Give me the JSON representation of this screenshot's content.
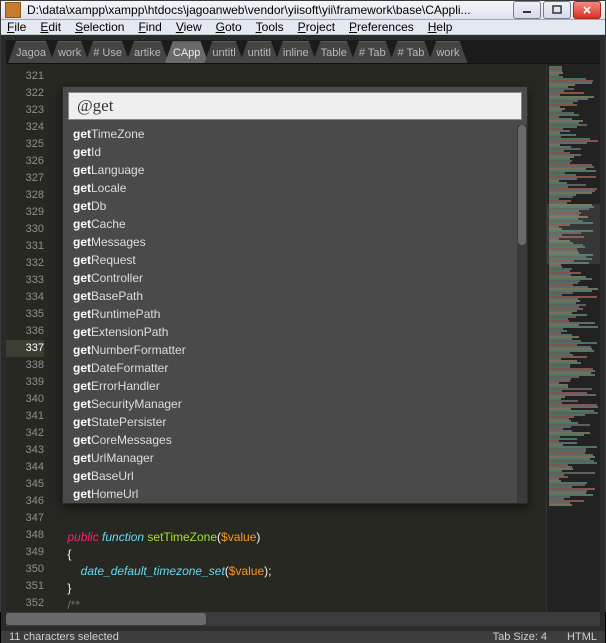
{
  "window": {
    "title": "D:\\data\\xampp\\xampp\\htdocs\\jagoanweb\\vendor\\yiisoft\\yii\\framework\\base\\CAppli..."
  },
  "menu": {
    "items": [
      "File",
      "Edit",
      "Selection",
      "Find",
      "View",
      "Goto",
      "Tools",
      "Project",
      "Preferences",
      "Help"
    ]
  },
  "tabs": {
    "items": [
      "Jagoa",
      "work",
      "# Use",
      "artike",
      "CApp",
      "untitl",
      "untitl",
      "inline",
      "Table",
      "# Tab",
      "# Tab",
      "work"
    ],
    "active_index": 4
  },
  "gutter": {
    "start": 321,
    "end": 352,
    "highlighted": 337
  },
  "palette": {
    "query": "@get",
    "results": [
      {
        "match": "get",
        "rest": "TimeZone"
      },
      {
        "match": "get",
        "rest": "Id"
      },
      {
        "match": "get",
        "rest": "Language"
      },
      {
        "match": "get",
        "rest": "Locale"
      },
      {
        "match": "get",
        "rest": "Db"
      },
      {
        "match": "get",
        "rest": "Cache"
      },
      {
        "match": "get",
        "rest": "Messages"
      },
      {
        "match": "get",
        "rest": "Request"
      },
      {
        "match": "get",
        "rest": "Controller"
      },
      {
        "match": "get",
        "rest": "BasePath"
      },
      {
        "match": "get",
        "rest": "RuntimePath"
      },
      {
        "match": "get",
        "rest": "ExtensionPath"
      },
      {
        "match": "get",
        "rest": "NumberFormatter"
      },
      {
        "match": "get",
        "rest": "DateFormatter"
      },
      {
        "match": "get",
        "rest": "ErrorHandler"
      },
      {
        "match": "get",
        "rest": "SecurityManager"
      },
      {
        "match": "get",
        "rest": "StatePersister"
      },
      {
        "match": "get",
        "rest": "CoreMessages"
      },
      {
        "match": "get",
        "rest": "UrlManager"
      },
      {
        "match": "get",
        "rest": "BaseUrl"
      },
      {
        "match": "get",
        "rest": "HomeUrl"
      }
    ]
  },
  "code": {
    "l348": {
      "indent": "    ",
      "kw1": "public",
      "sp": " ",
      "kw2": "function",
      "sp2": " ",
      "fn": "setTimeZone",
      "open": "(",
      "var": "$value",
      "close": ")"
    },
    "l349": {
      "indent": "    ",
      "brace": "{"
    },
    "l350": {
      "indent": "        ",
      "call": "date_default_timezone_set",
      "open": "(",
      "var": "$value",
      "close": ");"
    },
    "l351": {
      "indent": "    ",
      "brace": "}"
    },
    "l352": {
      "indent": "    ",
      "cmt": "/**"
    }
  },
  "status": {
    "left": "11 characters selected",
    "tab_size": "Tab Size: 4",
    "syntax": "HTML"
  }
}
